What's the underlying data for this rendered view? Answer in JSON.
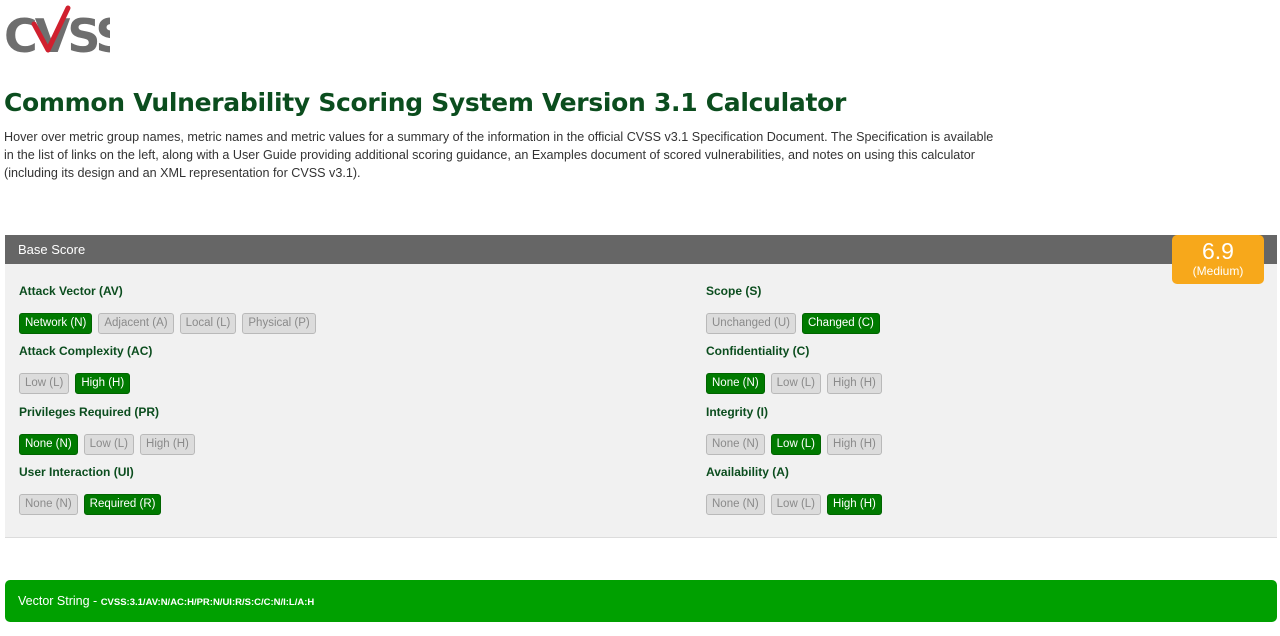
{
  "header": {
    "logo_text": "CVSS",
    "title": "Common Vulnerability Scoring System Version 3.1 Calculator",
    "intro": "Hover over metric group names, metric names and metric values for a summary of the information in the official CVSS v3.1 Specification Document. The Specification is available in the list of links on the left, along with a User Guide providing additional scoring guidance, an Examples document of scored vulnerabilities, and notes on using this calculator (including its design and an XML representation for CVSS v3.1)."
  },
  "base": {
    "header": "Base Score",
    "score": "6.9",
    "severity": "(Medium)",
    "metrics": [
      {
        "name": "Attack Vector (AV)",
        "options": [
          {
            "label": "Network (N)",
            "selected": true
          },
          {
            "label": "Adjacent (A)",
            "selected": false
          },
          {
            "label": "Local (L)",
            "selected": false
          },
          {
            "label": "Physical (P)",
            "selected": false
          }
        ]
      },
      {
        "name": "Attack Complexity (AC)",
        "options": [
          {
            "label": "Low (L)",
            "selected": false
          },
          {
            "label": "High (H)",
            "selected": true
          }
        ]
      },
      {
        "name": "Privileges Required (PR)",
        "options": [
          {
            "label": "None (N)",
            "selected": true
          },
          {
            "label": "Low (L)",
            "selected": false
          },
          {
            "label": "High (H)",
            "selected": false
          }
        ]
      },
      {
        "name": "User Interaction (UI)",
        "options": [
          {
            "label": "None (N)",
            "selected": false
          },
          {
            "label": "Required (R)",
            "selected": true
          }
        ]
      },
      {
        "name": "Scope (S)",
        "options": [
          {
            "label": "Unchanged (U)",
            "selected": false
          },
          {
            "label": "Changed (C)",
            "selected": true
          }
        ]
      },
      {
        "name": "Confidentiality (C)",
        "options": [
          {
            "label": "None (N)",
            "selected": true
          },
          {
            "label": "Low (L)",
            "selected": false
          },
          {
            "label": "High (H)",
            "selected": false
          }
        ]
      },
      {
        "name": "Integrity (I)",
        "options": [
          {
            "label": "None (N)",
            "selected": false
          },
          {
            "label": "Low (L)",
            "selected": true
          },
          {
            "label": "High (H)",
            "selected": false
          }
        ]
      },
      {
        "name": "Availability (A)",
        "options": [
          {
            "label": "None (N)",
            "selected": false
          },
          {
            "label": "Low (L)",
            "selected": false
          },
          {
            "label": "High (H)",
            "selected": true
          }
        ]
      }
    ]
  },
  "vector": {
    "label": "Vector String - ",
    "value": "CVSS:3.1/AV:N/AC:H/PR:N/UI:R/S:C/C:N/I:L/A:H"
  },
  "colors": {
    "title": "#0b4d1e",
    "selected": "#007a00",
    "unselected": "#dcdcdc",
    "score_badge": "#f7a81b",
    "vector_bar": "#00a000",
    "panel_header": "#666666"
  }
}
